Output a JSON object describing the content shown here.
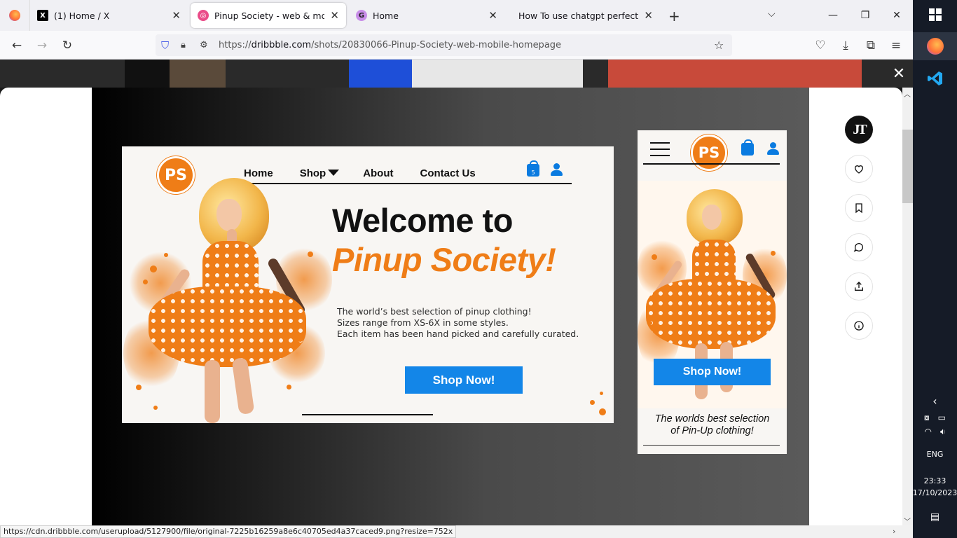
{
  "browser": {
    "tabs": [
      {
        "title": "",
        "favicon": "firefox-icon"
      },
      {
        "title": "(1) Home / X",
        "favicon": "x-logo-icon"
      },
      {
        "title": "Pinup Society - web & mobile h",
        "favicon": "dribbble-icon",
        "active": true
      },
      {
        "title": "Home",
        "favicon": "g-app-icon"
      },
      {
        "title": "How To use chatgpt perfectly.",
        "favicon": ""
      }
    ],
    "url_scheme": "https://",
    "url_host": "dribbble.com",
    "url_path": "/shots/20830066-Pinup-Society-web-mobile-homepage",
    "status_url": "https://cdn.dribbble.com/userupload/5127900/file/original-7225b16259a8e6c40705ed4a37caced9.png?resize=752x"
  },
  "desktop_mock": {
    "logo_text": "PS",
    "nav": [
      "Home",
      "Shop",
      "About",
      "Contact Us"
    ],
    "cart_count": "5",
    "title_line1": "Welcome to",
    "title_line2": "Pinup Society!",
    "copy": [
      "The world’s best selection of pinup clothing!",
      "Sizes range from XS-6X in some styles.",
      "Each item has been hand picked and carefully curated."
    ],
    "cta": "Shop Now!"
  },
  "mobile_mock": {
    "logo_text": "PS",
    "cta": "Shop Now!",
    "tagline_line1": "The worlds best selection",
    "tagline_line2": "of Pin-Up clothing!"
  },
  "rail": {
    "avatar_initials": "JT",
    "icons": [
      "heart-icon",
      "bookmark-icon",
      "comment-icon",
      "share-icon",
      "info-icon"
    ]
  },
  "taskbar": {
    "language": "ENG",
    "time": "23:33",
    "date": "17/10/2023"
  },
  "colors": {
    "brand_orange": "#ef7d17",
    "cta_blue": "#1386e8"
  }
}
